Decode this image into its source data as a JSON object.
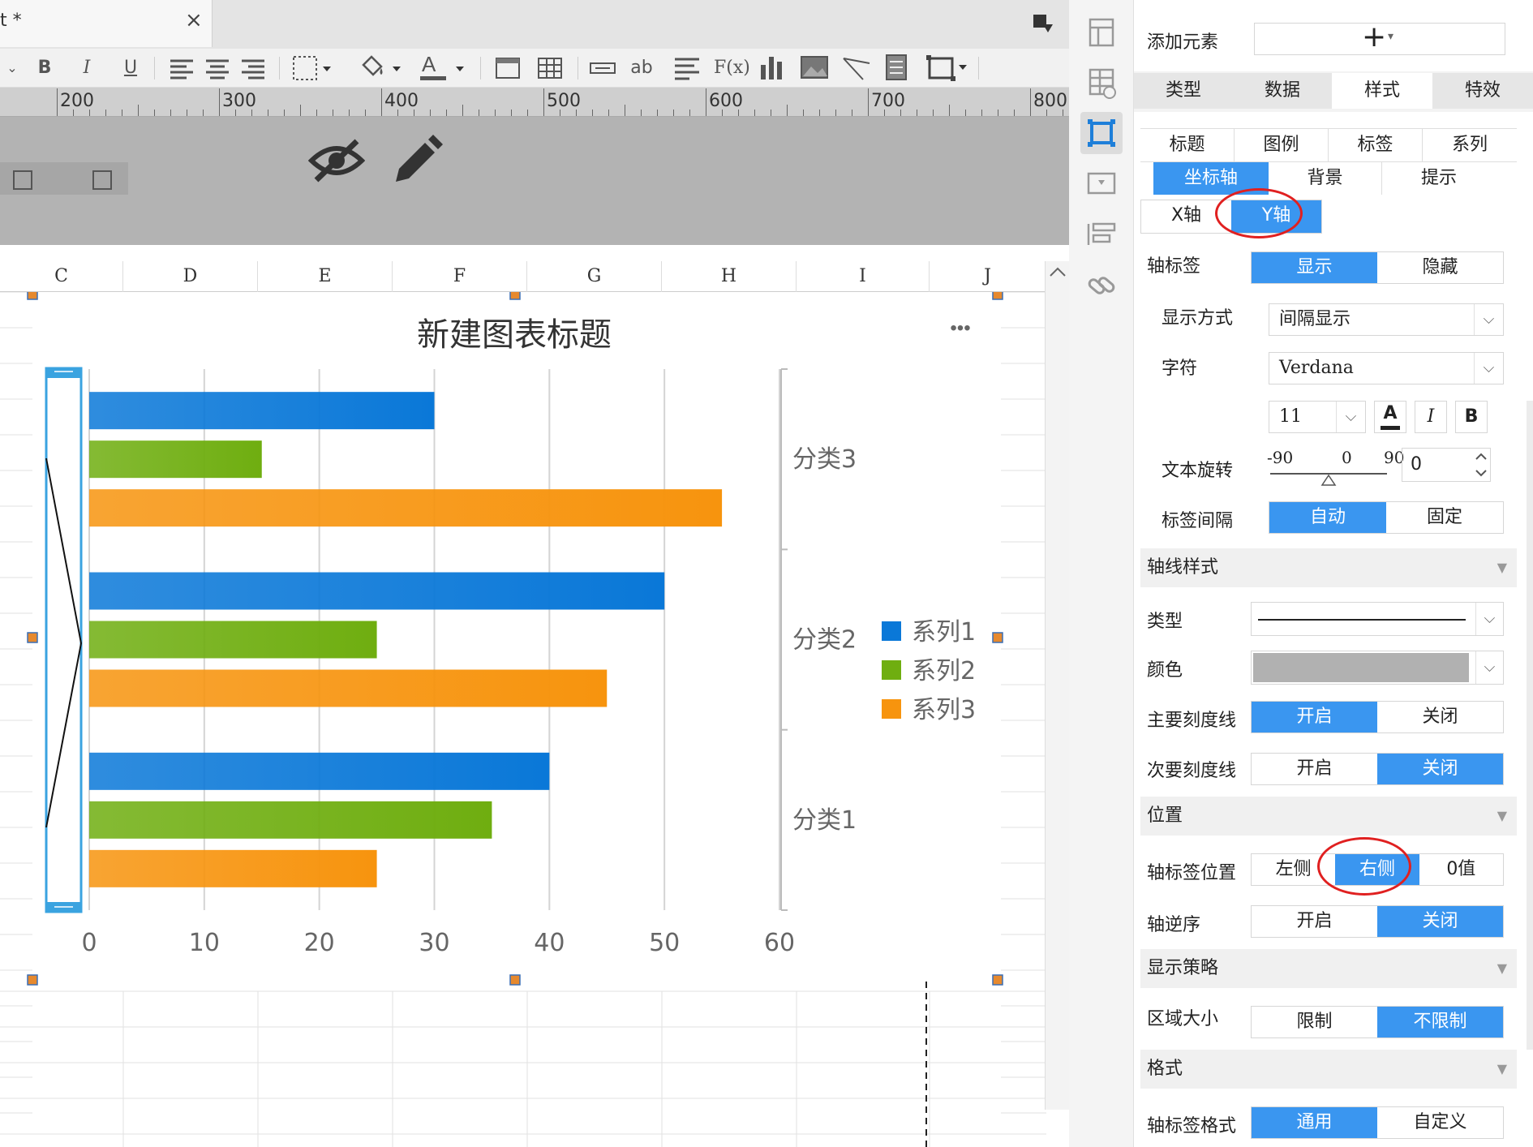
{
  "editor": {
    "tab_label": "t *",
    "tab_close": "×",
    "toolbar": {
      "bold": "B",
      "italic": "I",
      "underline": "U",
      "text_ab": "ab",
      "formula": "F(x)"
    },
    "ruler_labels": [
      "200",
      "300",
      "400",
      "500",
      "600",
      "700",
      "800"
    ],
    "columns": [
      "C",
      "D",
      "E",
      "F",
      "G",
      "H",
      "I",
      "J"
    ]
  },
  "chart_data": {
    "type": "bar",
    "orientation": "horizontal",
    "title": "新建图表标题",
    "more_label": "•••",
    "categories": [
      "分类1",
      "分类2",
      "分类3"
    ],
    "series": [
      {
        "name": "系列1",
        "color": "#0a78d8",
        "values": [
          40,
          50,
          30
        ]
      },
      {
        "name": "系列2",
        "color": "#6fae10",
        "values": [
          35,
          25,
          15
        ]
      },
      {
        "name": "系列3",
        "color": "#f7940e",
        "values": [
          25,
          45,
          55
        ]
      }
    ],
    "xlim": [
      0,
      60
    ],
    "x_ticks": [
      "0",
      "10",
      "20",
      "30",
      "40",
      "50",
      "60"
    ],
    "category_axis_position": "right",
    "grid": true,
    "legend": "right"
  },
  "sidebar_icons": [
    "layout-icon",
    "table-icon",
    "chart-frame-icon",
    "widget-icon",
    "list-icon",
    "link-icon"
  ],
  "panel": {
    "add_element_label": "添加元素",
    "add_button_glyph": "+",
    "main_tabs": [
      "类型",
      "数据",
      "样式",
      "特效"
    ],
    "sub_tabs_row1": [
      "标题",
      "图例",
      "标签",
      "系列"
    ],
    "sub_tabs_row2": [
      "坐标轴",
      "背景",
      "提示"
    ],
    "axis_tabs": [
      "X轴",
      "Y轴"
    ],
    "axis_label": {
      "label": "轴标签",
      "options": [
        "显示",
        "隐藏"
      ]
    },
    "display_mode": {
      "label": "显示方式",
      "value": "间隔显示"
    },
    "font": {
      "label": "字符",
      "value": "Verdana",
      "size": "11",
      "bold_glyph": "B",
      "italic_glyph": "I",
      "color_glyph": "A"
    },
    "rotation": {
      "label": "文本旋转",
      "min": "-90",
      "mid": "0",
      "max": "90",
      "value": "0"
    },
    "label_interval": {
      "label": "标签间隔",
      "options": [
        "自动",
        "固定"
      ]
    },
    "axis_line_section": "轴线样式",
    "line_type_label": "类型",
    "color_label": "颜色",
    "line_color": "#b1b1b1",
    "major_tick": {
      "label": "主要刻度线",
      "options": [
        "开启",
        "关闭"
      ]
    },
    "minor_tick": {
      "label": "次要刻度线",
      "options": [
        "开启",
        "关闭"
      ]
    },
    "position_section": "位置",
    "label_position": {
      "label": "轴标签位置",
      "options": [
        "左侧",
        "右侧",
        "0值"
      ]
    },
    "axis_reverse": {
      "label": "轴逆序",
      "options": [
        "开启",
        "关闭"
      ]
    },
    "display_strategy_section": "显示策略",
    "area_size": {
      "label": "区域大小",
      "options": [
        "限制",
        "不限制"
      ]
    },
    "format_section": "格式",
    "label_format": {
      "label": "轴标签格式",
      "options": [
        "通用",
        "自定义"
      ]
    }
  },
  "colors": {
    "accent": "#3a96f0",
    "annotation": "#e02020"
  }
}
